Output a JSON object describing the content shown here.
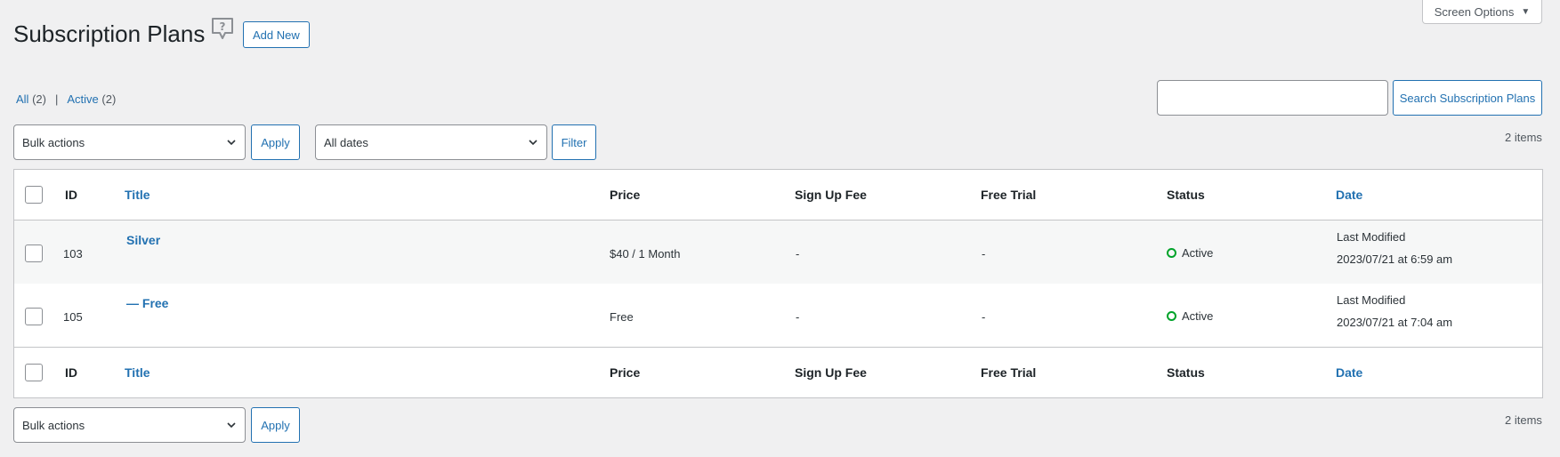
{
  "header": {
    "title": "Subscription Plans",
    "add_new": "Add New",
    "screen_options": "Screen Options"
  },
  "views": {
    "all_label": "All",
    "all_count": "(2)",
    "separator": "|",
    "active_label": "Active",
    "active_count": "(2)"
  },
  "search": {
    "value": "",
    "button": "Search Subscription Plans"
  },
  "tablenav_top": {
    "bulk_actions": "Bulk actions",
    "apply": "Apply",
    "dates": "All dates",
    "filter": "Filter",
    "items": "2 items"
  },
  "tablenav_bottom": {
    "bulk_actions": "Bulk actions",
    "apply": "Apply",
    "items": "2 items"
  },
  "table": {
    "columns": {
      "id": "ID",
      "title": "Title",
      "price": "Price",
      "signup_fee": "Sign Up Fee",
      "free_trial": "Free Trial",
      "status": "Status",
      "date": "Date"
    },
    "rows": [
      {
        "id": "103",
        "title": "Silver",
        "price": "$40 / 1 Month",
        "signup_fee": "-",
        "free_trial": "-",
        "status": "Active",
        "date_label": "Last Modified",
        "date_value": "2023/07/21 at 6:59 am"
      },
      {
        "id": "105",
        "title": "— Free",
        "price": "Free",
        "signup_fee": "-",
        "free_trial": "-",
        "status": "Active",
        "date_label": "Last Modified",
        "date_value": "2023/07/21 at 7:04 am"
      }
    ]
  },
  "colors": {
    "accent": "#2271b1",
    "active_status": "#00a32a",
    "background": "#f0f0f1"
  },
  "icons": {
    "help": "help-bubble-icon",
    "caret": "caret-down-icon",
    "chevron": "chevron-down-icon"
  }
}
